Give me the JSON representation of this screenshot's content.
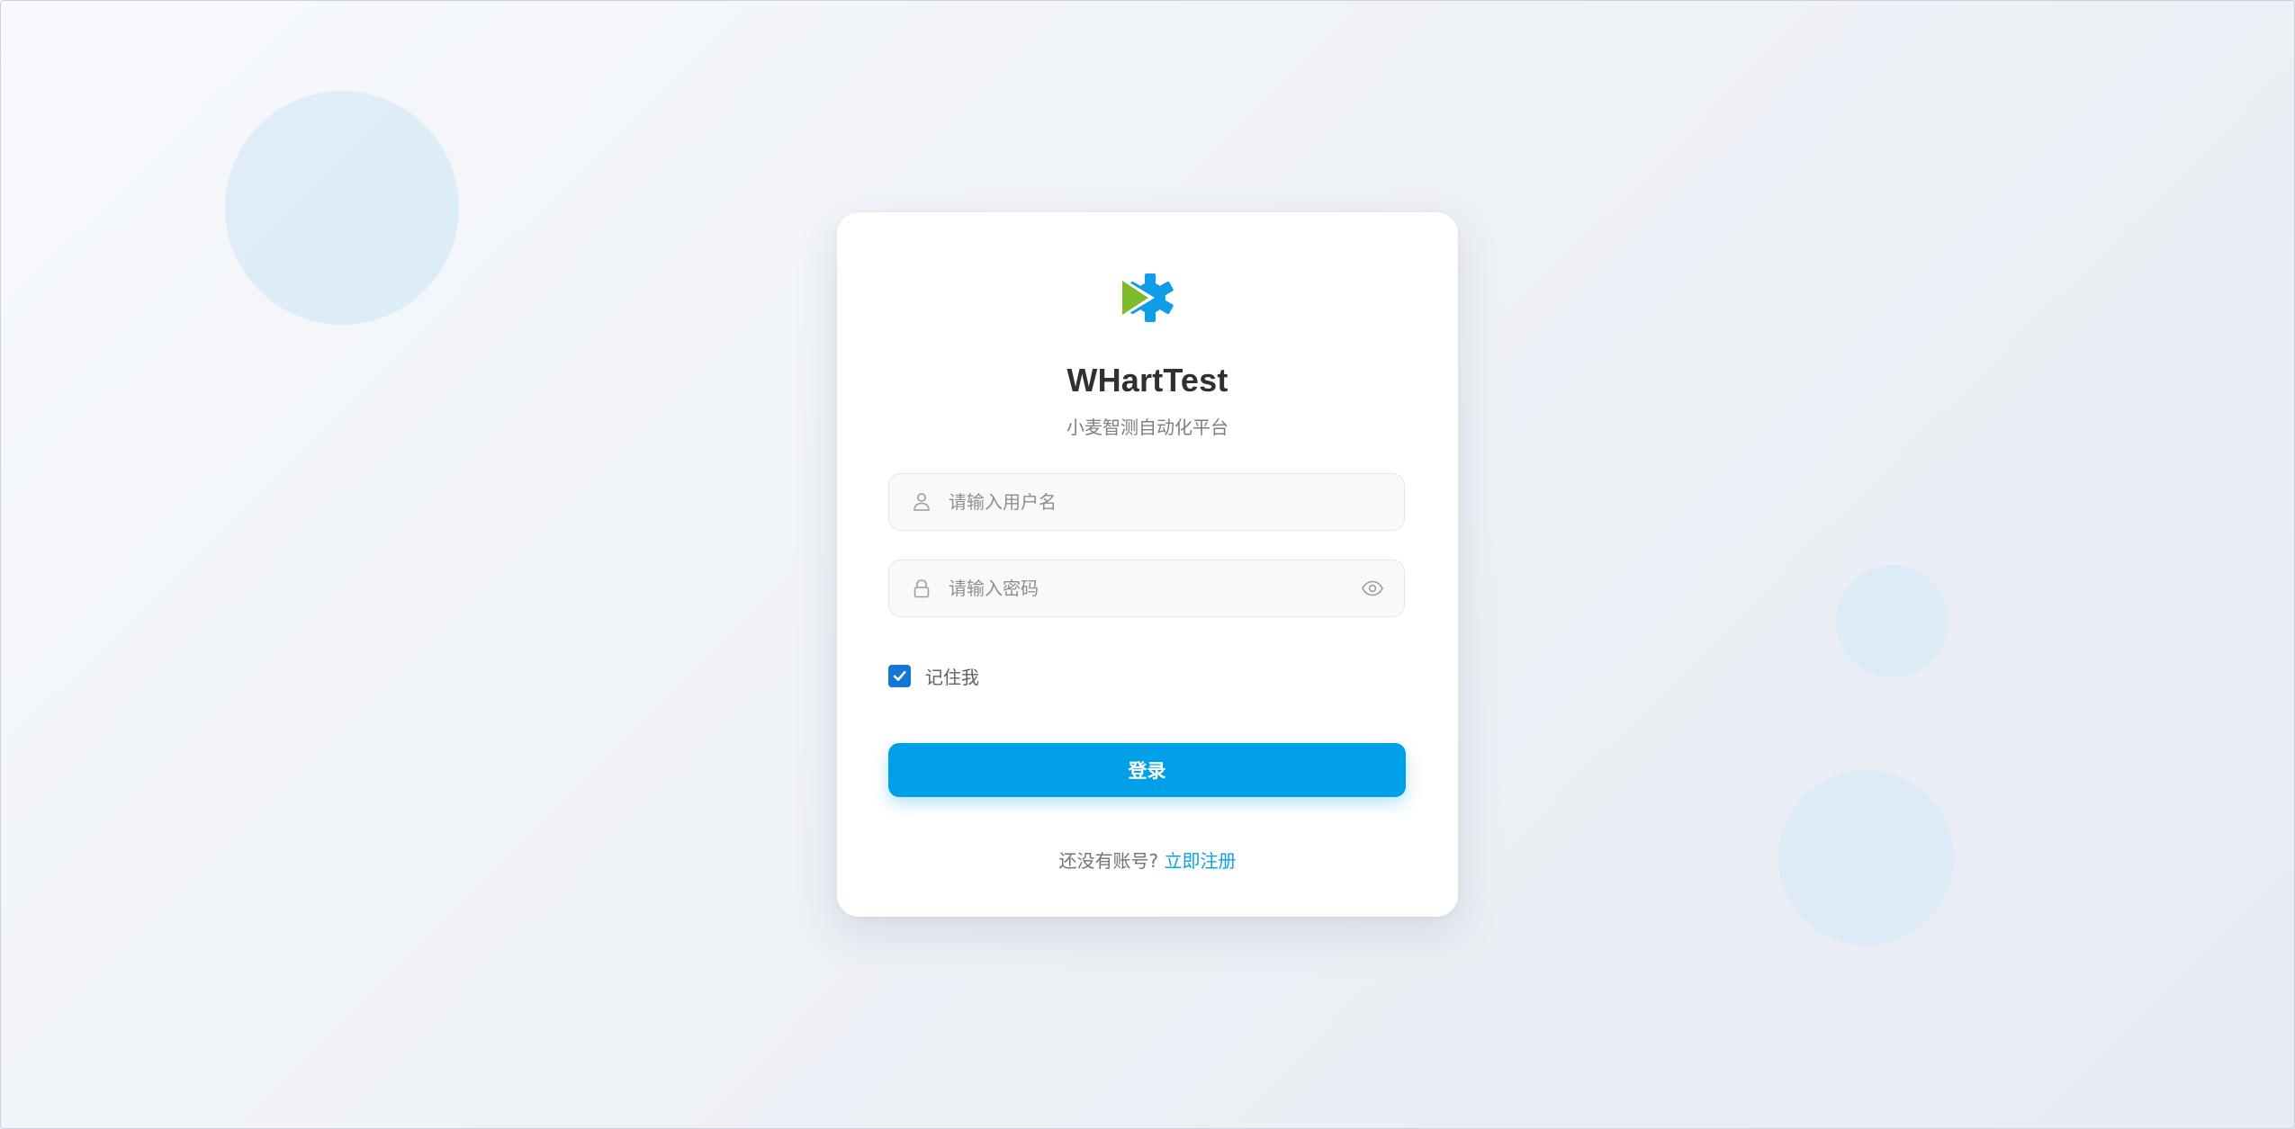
{
  "app": {
    "title": "WHartTest",
    "subtitle": "小麦智测自动化平台",
    "logo_icon": "play-gear-logo"
  },
  "login_form": {
    "username_placeholder": "请输入用户名",
    "username_value": "",
    "password_placeholder": "请输入密码",
    "password_value": "",
    "remember_label": "记住我",
    "remember_checked": true,
    "submit_label": "登录"
  },
  "register": {
    "prompt": "还没有账号?",
    "link_label": "立即注册"
  },
  "icons": {
    "username": "user-icon",
    "password": "lock-icon",
    "toggle_password": "eye-icon",
    "checkbox": "check-icon"
  },
  "colors": {
    "primary": "#00a0e8",
    "checkbox": "#1377d6",
    "logo_green": "#7cbc2c",
    "logo_blue": "#0f9de8",
    "bubble": "#d6e9f6"
  }
}
